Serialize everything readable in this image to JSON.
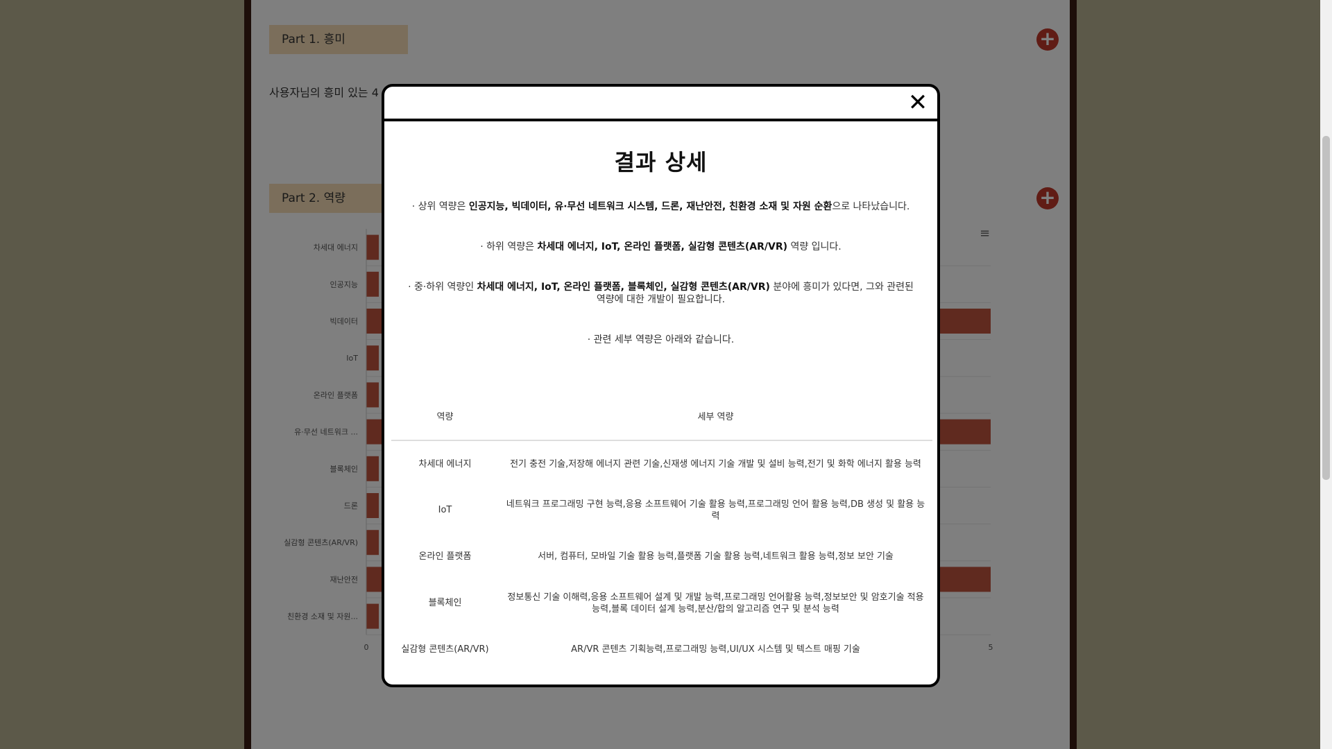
{
  "background": {
    "part1": {
      "label": "Part 1. 흥미",
      "intro": "사용자님의 흥미 있는 4"
    },
    "part2": {
      "label": "Part 2. 역량"
    },
    "chart_menu_icon": "hamburger-menu-icon"
  },
  "chart_data": {
    "type": "bar",
    "orientation": "horizontal",
    "categories": [
      "차세대 에너지",
      "인공지능",
      "빅데이터",
      "IoT",
      "온라인 플랫폼",
      "유·무선 네트워크 ...",
      "블록체인",
      "드론",
      "실감형 콘텐츠(AR/VR)",
      "재난안전",
      "친환경 소재 및 자원..."
    ],
    "values": [
      null,
      null,
      5,
      null,
      null,
      5,
      null,
      null,
      null,
      5,
      null
    ],
    "xlim": [
      0,
      5
    ],
    "x_ticks": [
      "0",
      "5"
    ],
    "bar_color": "#c0553f"
  },
  "modal": {
    "title": "결과 상세",
    "close_icon": "close-icon",
    "summary1": {
      "prefix": "· 상위 역량은 ",
      "bold": "인공지능, 빅데이터, 유·무선 네트워크 시스템, 드론, 재난안전, 친환경 소재 및 자원 순환",
      "suffix": "으로 나타났습니다."
    },
    "summary2": {
      "prefix": "· 하위 역량은 ",
      "bold": "차세대 에너지, IoT, 온라인 플랫폼, 실감형 콘텐츠(AR/VR)",
      "suffix": " 역량 입니다."
    },
    "summary3": {
      "prefix": "· 중·하위 역량인 ",
      "bold": "차세대 에너지, IoT, 온라인 플랫폼, 블록체인, 실감형 콘텐츠(AR/VR)",
      "suffix": " 분야에 흥미가 있다면, 그와 관련된 역량에 대한 개발이 필요합니다."
    },
    "summary4": "· 관련 세부 역량은 아래와 같습니다.",
    "table": {
      "headers": [
        "역량",
        "세부 역량"
      ],
      "rows": [
        {
          "competency": "차세대 에너지",
          "details": "전기 충전 기술,저장해 에너지 관련 기술,신재생 에너지 기술 개발 및 설비 능력,전기 및 화학 에너지 활용 능력"
        },
        {
          "competency": "IoT",
          "details": "네트워크 프로그래밍 구현 능력,응용 소프트웨어 기술 활용 능력,프로그래밍 언어 활용 능력,DB 생성 및 활용 능력"
        },
        {
          "competency": "온라인 플랫폼",
          "details": "서버, 컴퓨터, 모바일 기술 활용 능력,플랫폼 기술 활용 능력,네트워크 활용 능력,정보 보안 기술"
        },
        {
          "competency": "블록체인",
          "details": "정보통신 기술 이해력,응용 소프트웨어 설계 및 개발 능력,프로그래밍 언어활용 능력,정보보안 및 암호기술 적용 능력,블록 데이터 설계 능력,분산/합의 알고리즘 연구 및 분석 능력"
        },
        {
          "competency": "실감형 콘텐츠(AR/VR)",
          "details": "AR/VR 콘텐츠 기획능력,프로그래밍 능력,UI/UX 시스템 및 텍스트 매핑 기술"
        }
      ]
    }
  }
}
